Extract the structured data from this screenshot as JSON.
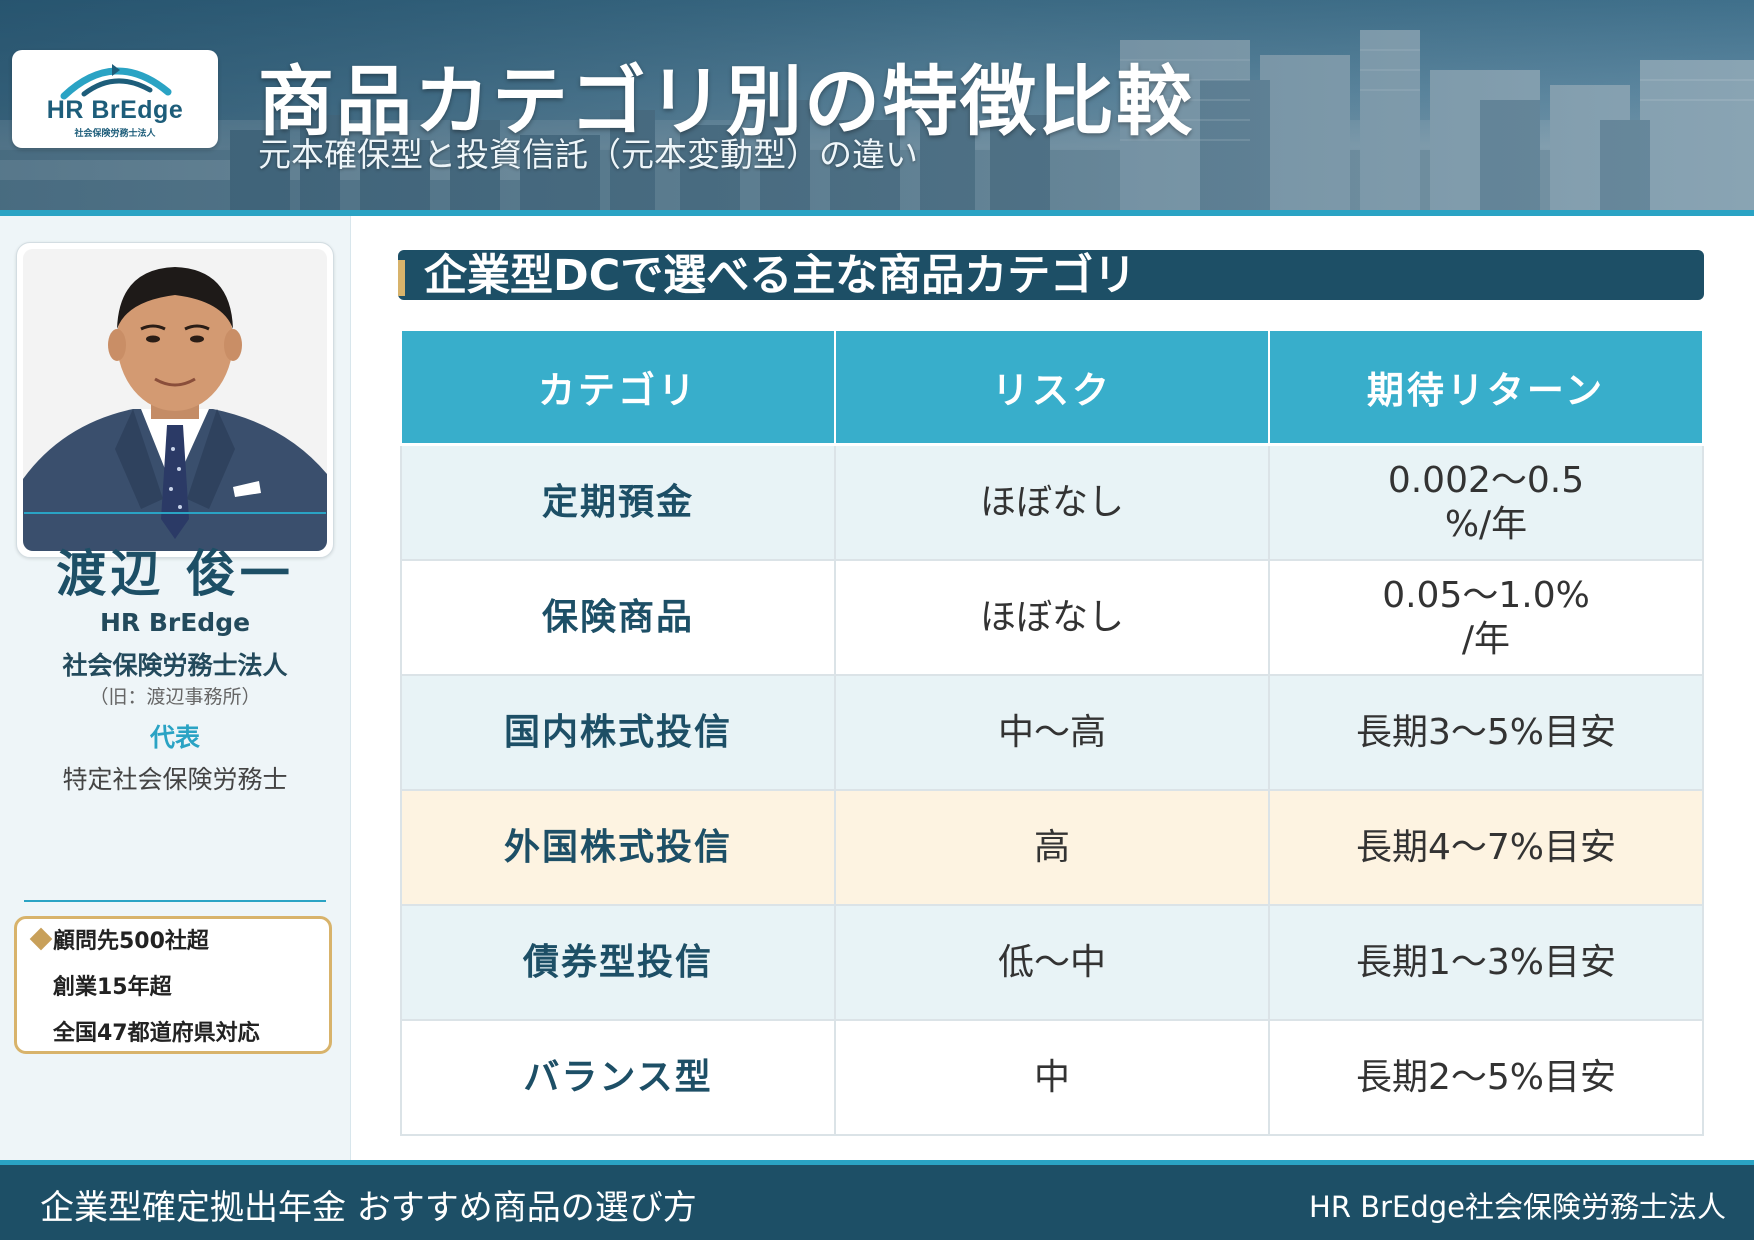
{
  "header": {
    "logo_text": "HR BrEdge",
    "logo_sub": "社会保険労務士法人",
    "title": "商品カテゴリ別の特徴比較",
    "subtitle": "元本確保型と投資信託（元本変動型）の違い"
  },
  "sidebar": {
    "name": "渡辺 俊一",
    "org_line1": "HR BrEdge",
    "org_line2": "社会保険労務士法人",
    "org_note": "（旧：渡辺事務所）",
    "role": "代表",
    "role_sub": "特定社会保険労務士",
    "highlights": [
      "顧問先500社超",
      "創業15年超",
      "全国47都道府県対応"
    ]
  },
  "main": {
    "section_heading": "企業型DCで選べる主な商品カテゴリ",
    "table": {
      "headers": [
        "カテゴリ",
        "リスク",
        "期待リターン"
      ],
      "rows": [
        {
          "category": "定期預金",
          "risk": "ほぼなし",
          "return_line1": "0.002～0.5",
          "return_line2": "%/年"
        },
        {
          "category": "保険商品",
          "risk": "ほぼなし",
          "return_line1": "0.05～1.0%",
          "return_line2": "/年"
        },
        {
          "category": "国内株式投信",
          "risk": "中～高",
          "return_line1": "長期3～5%目安",
          "return_line2": ""
        },
        {
          "category": "外国株式投信",
          "risk": "高",
          "return_line1": "長期4～7%目安",
          "return_line2": ""
        },
        {
          "category": "債券型投信",
          "risk": "低～中",
          "return_line1": "長期1～3%目安",
          "return_line2": ""
        },
        {
          "category": "バランス型",
          "risk": "中",
          "return_line1": "長期2～5%目安",
          "return_line2": ""
        }
      ]
    }
  },
  "footer": {
    "left": "企業型確定拠出年金 おすすめ商品の選び方",
    "right": "HR BrEdge社会保険労務士法人"
  },
  "colors": {
    "navy": "#1d4f66",
    "teal": "#38aecb",
    "gold": "#d8b36b",
    "highlight_row": "#fdf3e1",
    "alt_row": "#e8f3f6"
  }
}
